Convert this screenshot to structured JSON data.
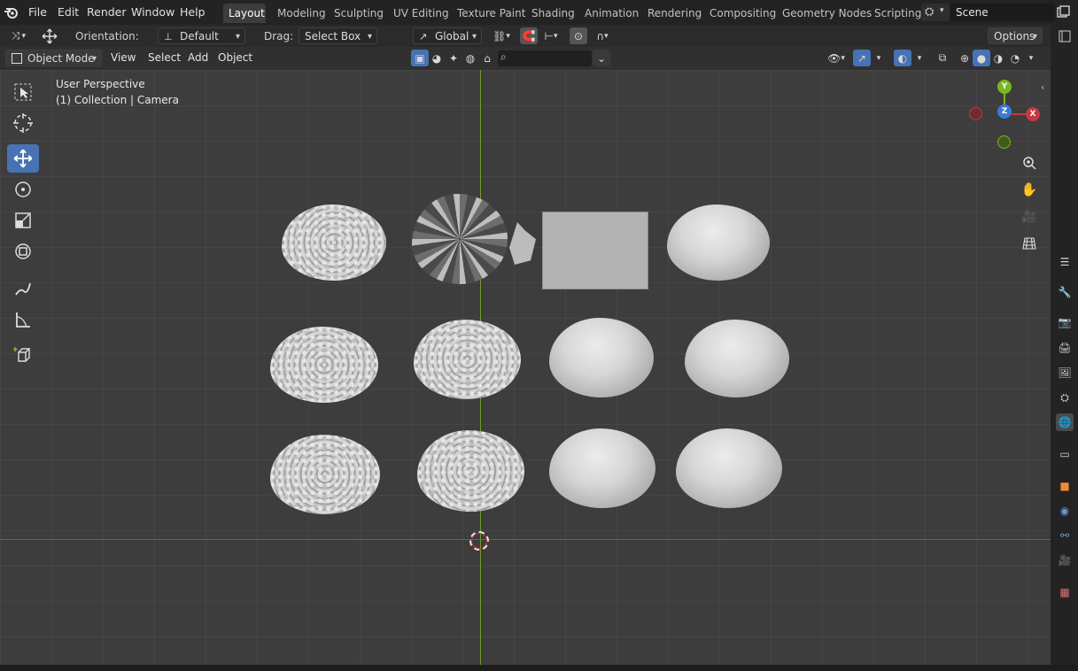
{
  "menu": {
    "items": [
      "File",
      "Edit",
      "Render",
      "Window",
      "Help"
    ]
  },
  "workspaces": {
    "tabs": [
      "Layout",
      "Modeling",
      "Sculpting",
      "UV Editing",
      "Texture Paint",
      "Shading",
      "Animation",
      "Rendering",
      "Compositing",
      "Geometry Nodes",
      "Scripting"
    ],
    "active": "Layout"
  },
  "scene": {
    "name": "Scene"
  },
  "tool_header": {
    "orientation_label": "Orientation:",
    "orientation_value": "Default",
    "drag_label": "Drag:",
    "drag_value": "Select Box",
    "transform_orientation": "Global",
    "options_label": "Options"
  },
  "viewport_header": {
    "mode": "Object Mode",
    "view": "View",
    "select": "Select",
    "add": "Add",
    "object": "Object"
  },
  "viewport": {
    "perspective": "User Perspective",
    "collection_info": "(1) Collection | Camera"
  },
  "gizmo": {
    "y": "Y",
    "z": "Z",
    "x": "X"
  },
  "colors": {
    "accent_blue": "#4772b3",
    "x_axis": "#c6383f",
    "y_axis": "#7ab624",
    "z_axis": "#3a7ad8"
  }
}
